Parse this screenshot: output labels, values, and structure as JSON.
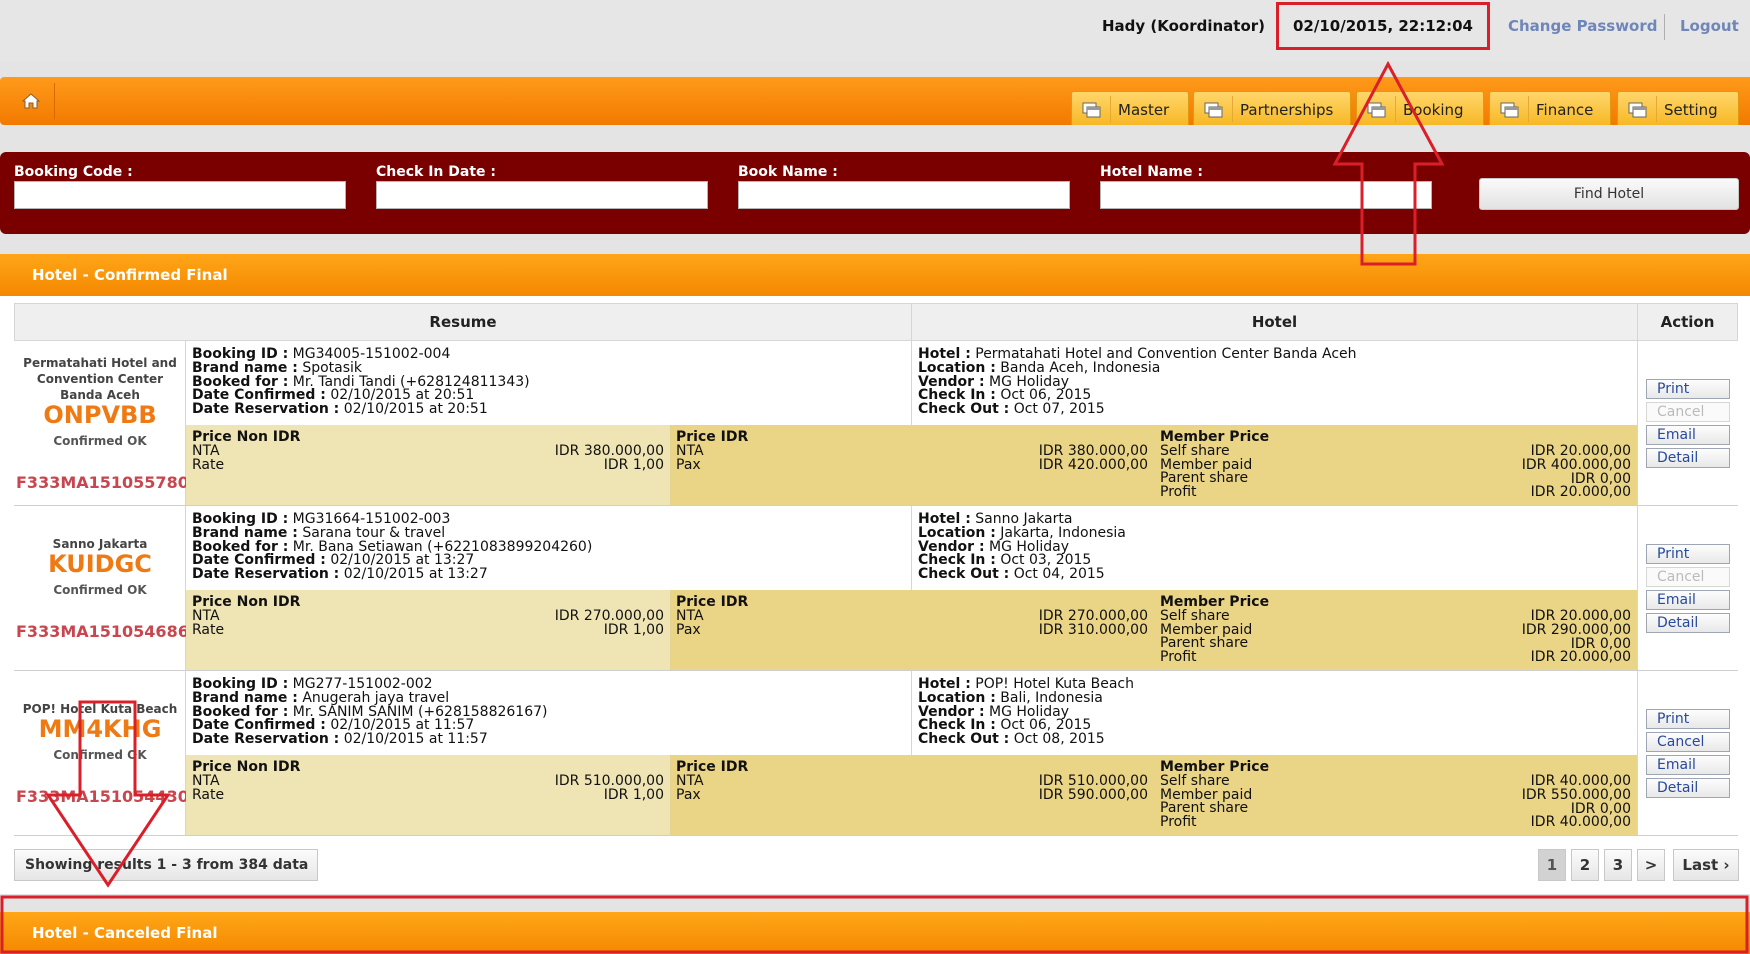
{
  "header": {
    "user": "Hady (Koordinator)",
    "datetime": "02/10/2015, 22:12:04",
    "change_password": "Change Password",
    "logout": "Logout"
  },
  "nav": {
    "tabs": [
      {
        "label": "Master"
      },
      {
        "label": "Partnerships"
      },
      {
        "label": "Booking"
      },
      {
        "label": "Finance"
      },
      {
        "label": "Setting"
      }
    ]
  },
  "search": {
    "labels": {
      "booking_code": "Booking Code :",
      "check_in_date": "Check In Date :",
      "book_name": "Book Name :",
      "hotel_name": "Hotel Name :"
    },
    "values": {
      "booking_code": "",
      "check_in_date": "",
      "book_name": "",
      "hotel_name": ""
    },
    "find_button": "Find Hotel"
  },
  "confirmed_section": {
    "title": "Hotel - Confirmed Final",
    "columns": {
      "resume": "Resume",
      "hotel": "Hotel",
      "action": "Action"
    }
  },
  "field_labels": {
    "booking_id": "Booking ID :",
    "brand_name": "Brand name :",
    "booked_for": "Booked for :",
    "date_confirmed": "Date Confirmed :",
    "date_reservation": "Date Reservation :",
    "hotel": "Hotel :",
    "location": "Location :",
    "vendor": "Vendor :",
    "check_in": "Check In :",
    "check_out": "Check Out :",
    "price_non_idr": "Price Non IDR",
    "price_idr": "Price IDR",
    "member_price": "Member Price",
    "nta": "NTA",
    "rate": "Rate",
    "pax": "Pax",
    "self_share": "Self share",
    "member_paid": "Member paid",
    "parent_share": "Parent share",
    "profit": "Profit"
  },
  "bookings": [
    {
      "hotel_short": "Permatahati Hotel and Convention Center Banda Aceh",
      "pnr": "ONPVBB",
      "status": "Confirmed OK",
      "booking_code": "F333MA151055780",
      "booking_id": "MG34005-151002-004",
      "brand_name": "Spotasik",
      "booked_for": "Mr. Tandi Tandi (+628124811343)",
      "date_confirmed": "02/10/2015 at 20:51",
      "date_reservation": "02/10/2015 at 20:51",
      "hotel": "Permatahati Hotel and Convention Center Banda Aceh",
      "location": "Banda Aceh, Indonesia",
      "vendor": "MG Holiday",
      "check_in": "Oct 06, 2015",
      "check_out": "Oct 07, 2015",
      "non_idr_nta": "IDR 380.000,00",
      "non_idr_rate": "IDR 1,00",
      "idr_nta": "IDR 380.000,00",
      "idr_pax": "IDR 420.000,00",
      "self_share": "IDR 20.000,00",
      "member_paid": "IDR 400.000,00",
      "parent_share": "IDR 0,00",
      "profit": "IDR 20.000,00",
      "actions": [
        "Print",
        "Cancel",
        "Email",
        "Detail"
      ],
      "cancel_enabled": false
    },
    {
      "hotel_short": "Sanno Jakarta",
      "pnr": "KUIDGC",
      "status": "Confirmed OK",
      "booking_code": "F333MA151054686",
      "booking_id": "MG31664-151002-003",
      "brand_name": "Sarana tour & travel",
      "booked_for": "Mr. Bana Setiawan (+6221083899204260)",
      "date_confirmed": "02/10/2015 at 13:27",
      "date_reservation": "02/10/2015 at 13:27",
      "hotel": "Sanno Jakarta",
      "location": "Jakarta, Indonesia",
      "vendor": "MG Holiday",
      "check_in": "Oct 03, 2015",
      "check_out": "Oct 04, 2015",
      "non_idr_nta": "IDR 270.000,00",
      "non_idr_rate": "IDR 1,00",
      "idr_nta": "IDR 270.000,00",
      "idr_pax": "IDR 310.000,00",
      "self_share": "IDR 20.000,00",
      "member_paid": "IDR 290.000,00",
      "parent_share": "IDR 0,00",
      "profit": "IDR 20.000,00",
      "actions": [
        "Print",
        "Cancel",
        "Email",
        "Detail"
      ],
      "cancel_enabled": false
    },
    {
      "hotel_short": "POP! Hotel Kuta Beach",
      "pnr": "MM4KHG",
      "status": "Confirmed OK",
      "booking_code": "F333MA151054430",
      "booking_id": "MG277-151002-002",
      "brand_name": "Anugerah jaya travel",
      "booked_for": "Mr. SANIM SANIM (+628158826167)",
      "date_confirmed": "02/10/2015 at 11:57",
      "date_reservation": "02/10/2015 at 11:57",
      "hotel": "POP! Hotel Kuta Beach",
      "location": "Bali, Indonesia",
      "vendor": "MG Holiday",
      "check_in": "Oct 06, 2015",
      "check_out": "Oct 08, 2015",
      "non_idr_nta": "IDR 510.000,00",
      "non_idr_rate": "IDR 1,00",
      "idr_nta": "IDR 510.000,00",
      "idr_pax": "IDR 590.000,00",
      "self_share": "IDR 40.000,00",
      "member_paid": "IDR 550.000,00",
      "parent_share": "IDR 0,00",
      "profit": "IDR 40.000,00",
      "actions": [
        "Print",
        "Cancel",
        "Email",
        "Detail"
      ],
      "cancel_enabled": true
    }
  ],
  "pagination": {
    "info": "Showing results 1 - 3 from 384 data",
    "pages": [
      "1",
      "2",
      "3",
      ">",
      "Last ›"
    ],
    "current": "1"
  },
  "canceled_section": {
    "title": "Hotel - Canceled Final"
  },
  "colors": {
    "orange": "#f48800",
    "maroon": "#7a0000",
    "annotation_red": "#d9202a",
    "price_bg_light": "#efe4b4",
    "price_bg_dark": "#ead486"
  }
}
